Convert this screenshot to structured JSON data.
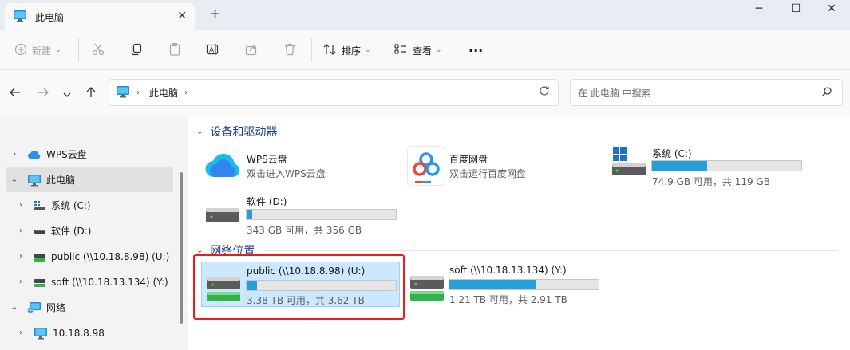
{
  "window": {
    "tab_title": "此电脑",
    "tab_close": "✕",
    "new_tab": "+",
    "minimize": "─",
    "maximize": "☐",
    "close": "✕"
  },
  "toolbar": {
    "new_label": "新建",
    "sort_label": "排序",
    "view_label": "查看",
    "more_label": "···"
  },
  "address": {
    "crumb": "此电脑",
    "search_placeholder": "在 此电脑 中搜索"
  },
  "sidebar": {
    "items": [
      {
        "label": "WPS云盘",
        "expander": "›"
      },
      {
        "label": "此电脑",
        "expander": "⌄"
      },
      {
        "label": "系统 (C:)",
        "expander": "›"
      },
      {
        "label": "软件 (D:)",
        "expander": "›"
      },
      {
        "label": "public (\\\\10.18.8.98) (U:)",
        "expander": "›"
      },
      {
        "label": "soft (\\\\10.18.13.134) (Y:)",
        "expander": "›"
      },
      {
        "label": "网络",
        "expander": "⌄"
      },
      {
        "label": "10.18.8.98",
        "expander": "›"
      }
    ]
  },
  "content": {
    "groups": [
      {
        "title": "设备和驱动器",
        "chevron": "⌄"
      },
      {
        "title": "网络位置",
        "chevron": "⌄"
      }
    ],
    "tiles": [
      {
        "name": "WPS云盘",
        "sub": "双击进入WPS云盘"
      },
      {
        "name": "百度网盘",
        "sub": "双击运行百度网盘"
      },
      {
        "name": "系统 (C:)",
        "sub": "74.9 GB 可用，共 119 GB",
        "used_fraction": 0.37
      },
      {
        "name": "软件 (D:)",
        "sub": "343 GB 可用，共 356 GB",
        "used_fraction": 0.04
      },
      {
        "name": "public (\\\\10.18.8.98) (U:)",
        "sub": "3.38 TB 可用，共 3.62 TB",
        "used_fraction": 0.07
      },
      {
        "name": "soft (\\\\10.18.13.134) (Y:)",
        "sub": "1.21 TB 可用，共 2.91 TB",
        "used_fraction": 0.58
      }
    ]
  },
  "colors": {
    "accent": "#26a0da",
    "selection": "#cce8ff",
    "highlight": "#e81c1c"
  }
}
